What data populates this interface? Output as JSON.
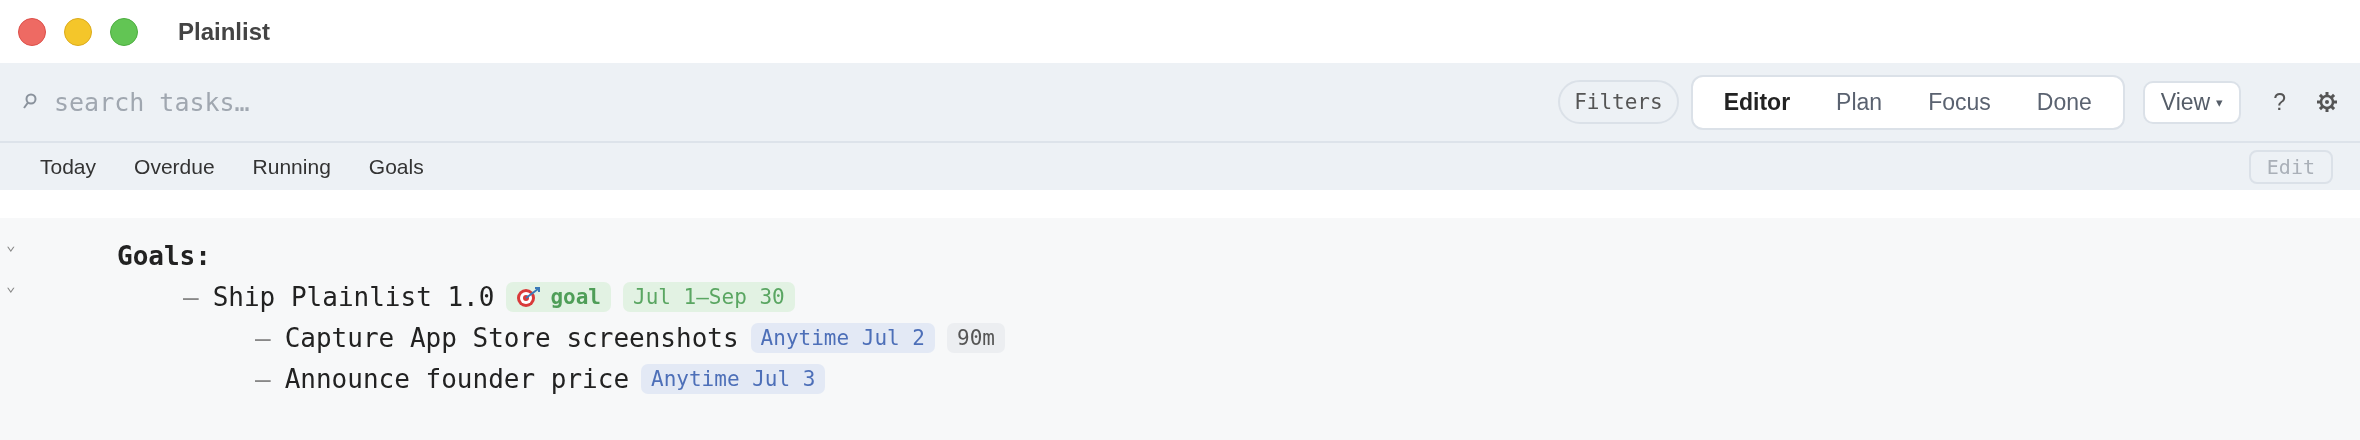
{
  "window": {
    "title": "Plainlist"
  },
  "search": {
    "placeholder": "search tasks…"
  },
  "filters_button": {
    "label": "Filters"
  },
  "mode_tabs": [
    {
      "label": "Editor",
      "selected": true
    },
    {
      "label": "Plan",
      "selected": false
    },
    {
      "label": "Focus",
      "selected": false
    },
    {
      "label": "Done",
      "selected": false
    }
  ],
  "view_button": {
    "label": "View",
    "caret": "▾"
  },
  "help_button": {
    "label": "?"
  },
  "quick_filters": [
    "Today",
    "Overdue",
    "Running",
    "Goals"
  ],
  "edit_button": {
    "label": "Edit",
    "disabled": true
  },
  "outline": [
    {
      "kind": "heading",
      "toggle": "⌄",
      "text": "Goals:",
      "expanded": true,
      "children": [
        {
          "kind": "task",
          "toggle": "⌄",
          "marker": "–",
          "text": "Ship Plainlist 1.0",
          "expanded": true,
          "tags": [
            {
              "kind": "goal",
              "text": "goal"
            },
            {
              "kind": "range",
              "text": "Jul 1–Sep 30"
            }
          ],
          "children": [
            {
              "kind": "task",
              "marker": "–",
              "text": "Capture App Store screenshots",
              "tags": [
                {
                  "kind": "date",
                  "text": "Anytime Jul 2"
                },
                {
                  "kind": "duration",
                  "text": "90m"
                }
              ]
            },
            {
              "kind": "task",
              "marker": "–",
              "text": "Announce founder price",
              "tags": [
                {
                  "kind": "date",
                  "text": "Anytime Jul 3"
                }
              ]
            }
          ]
        }
      ]
    }
  ]
}
